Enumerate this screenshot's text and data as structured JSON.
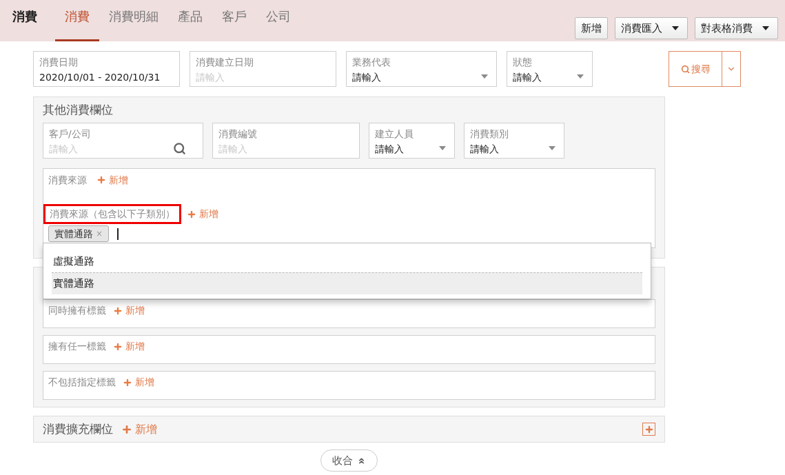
{
  "app_title": "消費",
  "tabs": [
    {
      "label": "消費",
      "selected": true
    },
    {
      "label": "消費明細",
      "selected": false
    },
    {
      "label": "產品",
      "selected": false
    },
    {
      "label": "客戶",
      "selected": false
    },
    {
      "label": "公司",
      "selected": false
    }
  ],
  "header_buttons": [
    {
      "label": "新增",
      "kind": "plain"
    },
    {
      "label": "消費匯入",
      "kind": "dropdown"
    },
    {
      "label": "對表格消費",
      "kind": "dropdown"
    }
  ],
  "filters": [
    {
      "label": "消費日期",
      "value": "2020/10/01 - 2020/10/31",
      "kind": "text"
    },
    {
      "label": "消費建立日期",
      "placeholder": "請輸入",
      "kind": "text"
    },
    {
      "label": "業務代表",
      "value": "請輸入",
      "kind": "select"
    },
    {
      "label": "狀態",
      "value": "請輸入",
      "kind": "select"
    }
  ],
  "search_button": {
    "label": "搜尋"
  },
  "other_fields": {
    "title": "其他消費欄位",
    "fields": [
      {
        "label": "客戶/公司",
        "placeholder": "請輸入",
        "kind": "search"
      },
      {
        "label": "消費編號",
        "placeholder": "請輸入",
        "kind": "text"
      },
      {
        "label": "建立人員",
        "value": "請輸入",
        "kind": "select"
      },
      {
        "label": "消費類別",
        "value": "請輸入",
        "kind": "select"
      }
    ],
    "source_box": {
      "label": "消費來源",
      "add": "新增",
      "sub_label": "消費來源（包含以下子類別）",
      "sub_highlighted": true,
      "sub_add": "新增",
      "chips": [
        {
          "label": "實體通路",
          "remove": "×"
        }
      ],
      "dropdown": [
        {
          "label": "虛擬通路",
          "selected": false
        },
        {
          "label": "實體通路",
          "selected": true
        }
      ]
    }
  },
  "tag_boxes": [
    {
      "label": "同時擁有標籤",
      "add": "新增"
    },
    {
      "label": "擁有任一標籤",
      "add": "新增"
    },
    {
      "label": "不包括指定標籤",
      "add": "新增"
    }
  ],
  "extension": {
    "title": "消費擴充欄位",
    "add": "新增"
  },
  "collapse_button": {
    "label": "收合"
  }
}
